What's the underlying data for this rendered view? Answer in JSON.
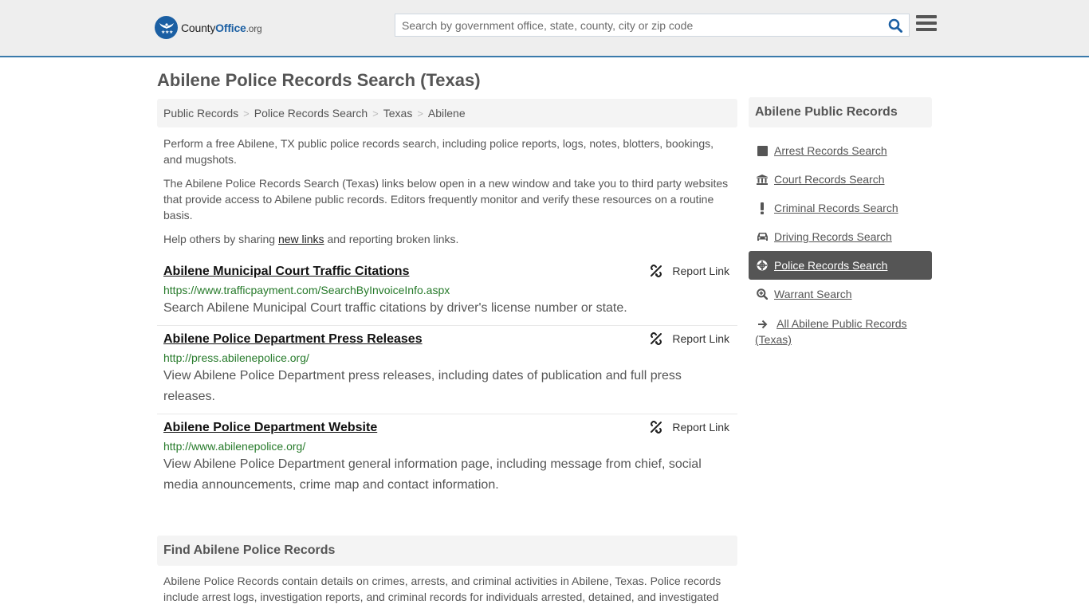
{
  "header": {
    "logo": {
      "name_part1": "County",
      "name_part2": "Office",
      "name_part3": ".org"
    },
    "search": {
      "placeholder": "Search by government office, state, county, city or zip code",
      "value": ""
    },
    "colors": {
      "accent": "#1b5fa3",
      "header_border": "#3a7aab",
      "header_bg": "#eeeeee"
    }
  },
  "page_title": "Abilene Police Records Search (Texas)",
  "breadcrumb": [
    {
      "label": "Public Records"
    },
    {
      "label": "Police Records Search"
    },
    {
      "label": "Texas"
    },
    {
      "label": "Abilene"
    }
  ],
  "intro": {
    "p1": "Perform a free Abilene, TX public police records search, including police reports, logs, notes, blotters, bookings, and mugshots.",
    "p2": "The Abilene Police Records Search (Texas) links below open in a new window and take you to third party websites that provide access to Abilene public records. Editors frequently monitor and verify these resources on a routine basis.",
    "p3_before": "Help others by sharing ",
    "p3_link": "new links",
    "p3_after": " and reporting broken links."
  },
  "results": [
    {
      "title": "Abilene Municipal Court Traffic Citations",
      "url": "https://www.trafficpayment.com/SearchByInvoiceInfo.aspx",
      "description": "Search Abilene Municipal Court traffic citations by driver's license number or state.",
      "report_label": "Report Link"
    },
    {
      "title": "Abilene Police Department Press Releases",
      "url": "http://press.abilenepolice.org/",
      "description": "View Abilene Police Department press releases, including dates of publication and full press releases.",
      "report_label": "Report Link"
    },
    {
      "title": "Abilene Police Department Website",
      "url": "http://www.abilenepolice.org/",
      "description": "View Abilene Police Department general information page, including message from chief, social media announcements, crime map and contact information.",
      "report_label": "Report Link"
    }
  ],
  "find_section": {
    "heading": "Find Abilene Police Records",
    "body": "Abilene Police Records contain details on crimes, arrests, and criminal activities in Abilene, Texas. Police records include arrest logs, investigation reports, and criminal records for individuals arrested, detained, and investigated"
  },
  "sidebar": {
    "heading": "Abilene Public Records",
    "items": [
      {
        "label": "Arrest Records Search",
        "icon": "square-icon",
        "active": false
      },
      {
        "label": "Court Records Search",
        "icon": "courthouse-icon",
        "active": false
      },
      {
        "label": "Criminal Records Search",
        "icon": "exclamation-icon",
        "active": false
      },
      {
        "label": "Driving Records Search",
        "icon": "car-icon",
        "active": false
      },
      {
        "label": "Police Records Search",
        "icon": "crosshairs-icon",
        "active": true
      },
      {
        "label": "Warrant Search",
        "icon": "search-plus-icon",
        "active": false
      },
      {
        "label": "All Abilene Public Records (Texas)",
        "icon": "arrow-right-icon",
        "active": false
      }
    ]
  }
}
